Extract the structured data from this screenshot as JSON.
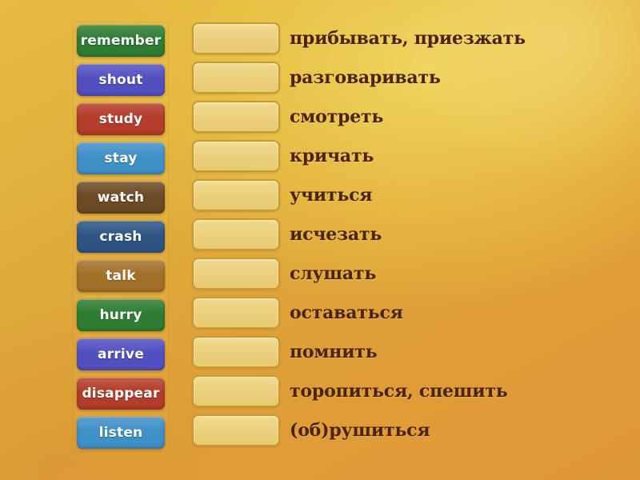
{
  "activity": {
    "type": "match-up",
    "background": {
      "top_right_color": "#dec24a",
      "bottom_left_color": "#e09a38"
    }
  },
  "word_tiles": [
    {
      "label": "remember",
      "color": "#2e7d32",
      "name": "word-tile-remember"
    },
    {
      "label": "shout",
      "color": "#5250c0",
      "name": "word-tile-shout"
    },
    {
      "label": "study",
      "color": "#b33c2a",
      "name": "word-tile-study"
    },
    {
      "label": "stay",
      "color": "#4090c8",
      "name": "word-tile-stay"
    },
    {
      "label": "watch",
      "color": "#6b4a26",
      "name": "word-tile-watch"
    },
    {
      "label": "crash",
      "color": "#2d5582",
      "name": "word-tile-crash"
    },
    {
      "label": "talk",
      "color": "#a3702a",
      "name": "word-tile-talk"
    },
    {
      "label": "hurry",
      "color": "#2e7d32",
      "name": "word-tile-hurry"
    },
    {
      "label": "arrive",
      "color": "#5250c0",
      "name": "word-tile-arrive"
    },
    {
      "label": "disappear",
      "color": "#b33c2a",
      "name": "word-tile-disappear"
    },
    {
      "label": "listen",
      "color": "#4090c8",
      "name": "word-tile-listen"
    }
  ],
  "drop_zones": [
    {
      "value": "",
      "name": "drop-zone-1"
    },
    {
      "value": "",
      "name": "drop-zone-2"
    },
    {
      "value": "",
      "name": "drop-zone-3"
    },
    {
      "value": "",
      "name": "drop-zone-4"
    },
    {
      "value": "",
      "name": "drop-zone-5"
    },
    {
      "value": "",
      "name": "drop-zone-6"
    },
    {
      "value": "",
      "name": "drop-zone-7"
    },
    {
      "value": "",
      "name": "drop-zone-8"
    },
    {
      "value": "",
      "name": "drop-zone-9"
    },
    {
      "value": "",
      "name": "drop-zone-10"
    },
    {
      "value": "",
      "name": "drop-zone-11"
    }
  ],
  "translations": [
    {
      "text": "прибывать, приезжать"
    },
    {
      "text": "разговаривать"
    },
    {
      "text": "смотреть"
    },
    {
      "text": "кричать"
    },
    {
      "text": "учиться"
    },
    {
      "text": "исчезать"
    },
    {
      "text": "слушать"
    },
    {
      "text": "оставаться"
    },
    {
      "text": "помнить"
    },
    {
      "text": "торопиться, спешить"
    },
    {
      "text": "(об)рушиться"
    }
  ]
}
